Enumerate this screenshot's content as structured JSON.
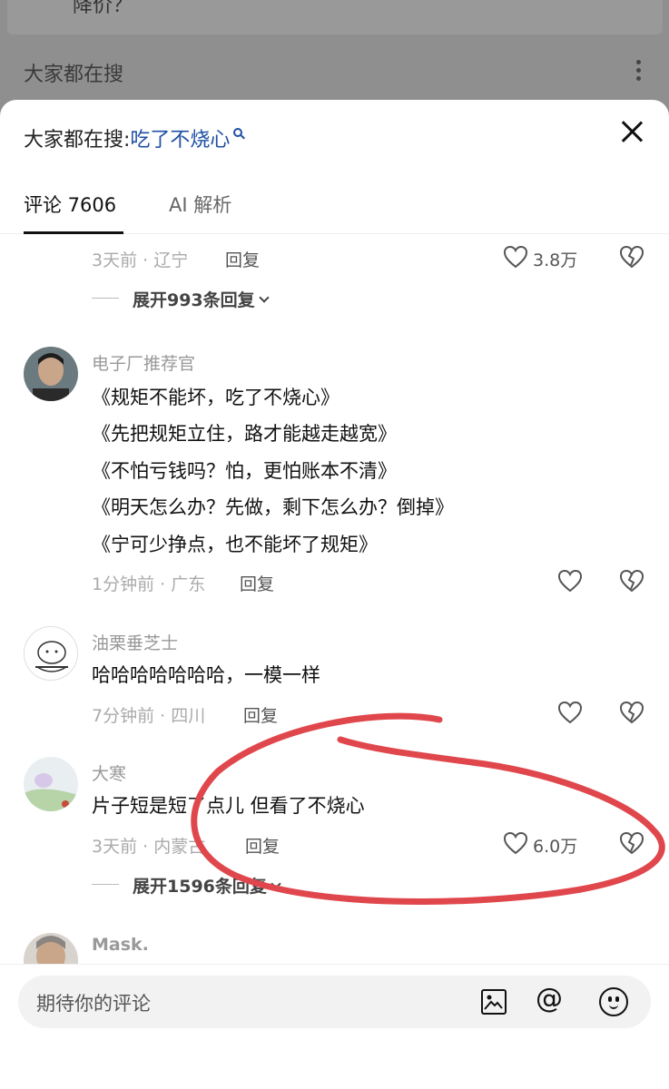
{
  "background": {
    "top_text": "降价？",
    "search_label": "大家都在搜"
  },
  "sheet": {
    "search_prefix": "大家都在搜:",
    "search_keyword": "吃了不烧心",
    "tabs": [
      {
        "label": "评论 7606",
        "active": true
      },
      {
        "label": "AI 解析",
        "active": false
      }
    ]
  },
  "comments": {
    "prev": {
      "meta": "3天前 · 辽宁",
      "reply": "回复",
      "likes": "3.8万",
      "expand": "展开993条回复"
    },
    "c1": {
      "username": "电子厂推荐官",
      "lines": [
        "《规矩不能坏，吃了不烧心》",
        "《先把规矩立住，路才能越走越宽》",
        "《不怕亏钱吗？怕，更怕账本不清》",
        "《明天怎么办？先做，剩下怎么办？倒掉》",
        "《宁可少挣点，也不能坏了规矩》"
      ],
      "meta": "1分钟前 · 广东",
      "reply": "回复"
    },
    "c2": {
      "username": "油栗垂芝士",
      "text": "哈哈哈哈哈哈哈，一模一样",
      "meta": "7分钟前 · 四川",
      "reply": "回复"
    },
    "c3": {
      "username": "大寒",
      "text": "片子短是短了点儿 但看了不烧心",
      "meta": "3天前 · 内蒙古",
      "reply": "回复",
      "likes": "6.0万",
      "expand": "展开1596条回复"
    },
    "c4": {
      "username": "Mask."
    }
  },
  "input": {
    "placeholder": "期待你的评论"
  },
  "colors": {
    "keyword": "#1e4fa3",
    "annotation": "#e0474c"
  },
  "icons": [
    "close-icon",
    "heart-icon",
    "broken-heart-icon",
    "image-icon",
    "at-icon",
    "emoji-icon",
    "search-icon",
    "more-icon"
  ]
}
